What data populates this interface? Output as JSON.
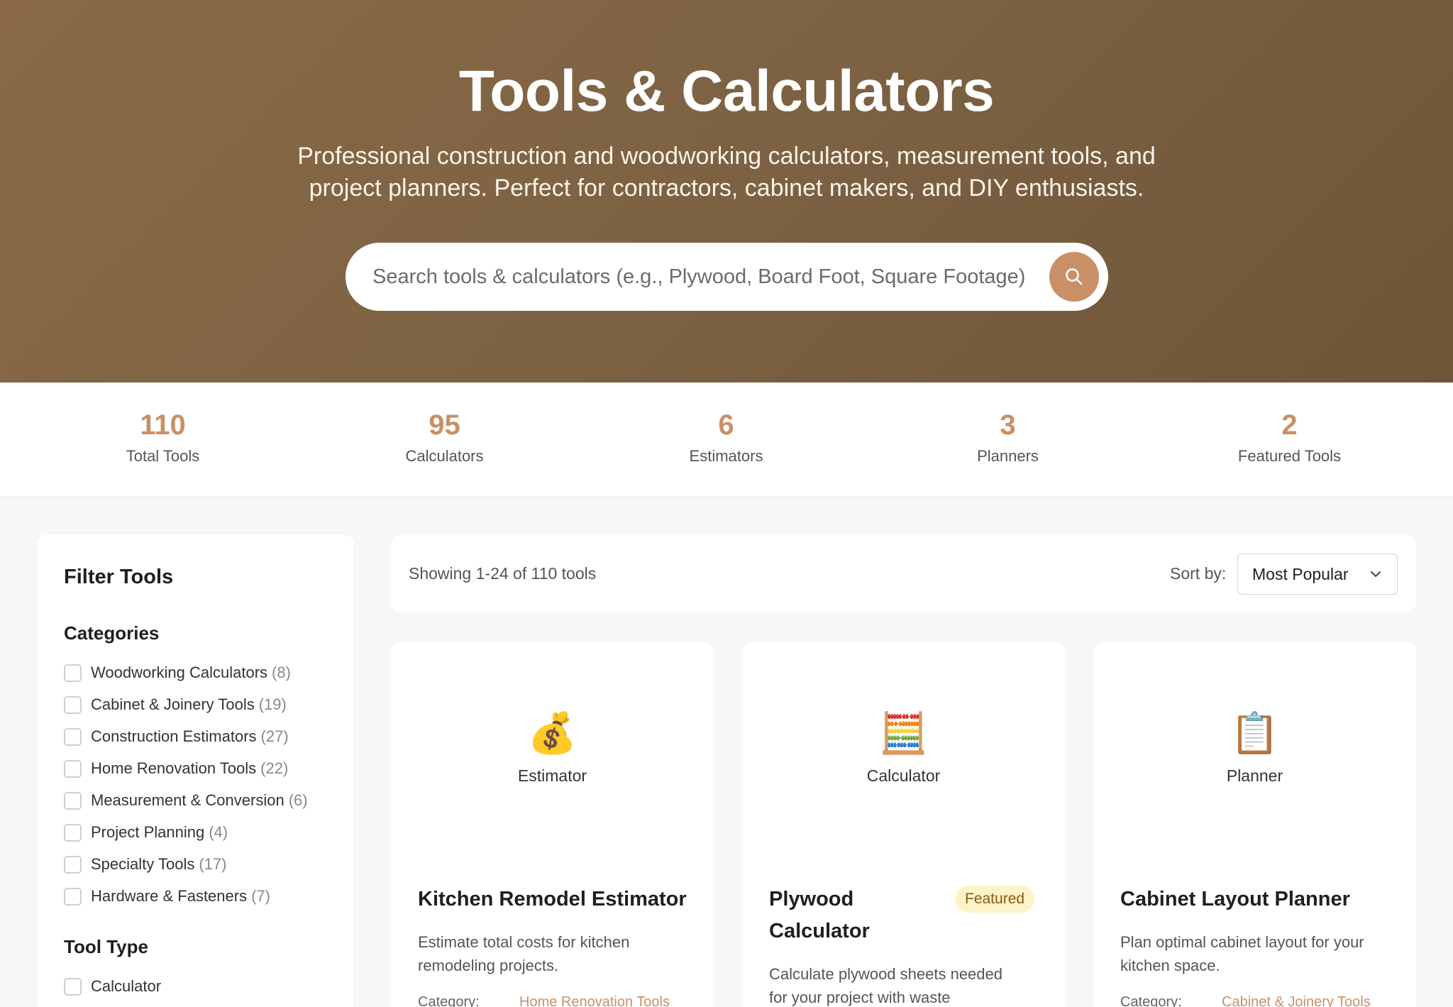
{
  "hero": {
    "title": "Tools & Calculators",
    "subtitle_line1": "Professional construction and woodworking calculators, measurement tools, and",
    "subtitle_line2": "project planners. Perfect for contractors, cabinet makers, and DIY enthusiasts.",
    "search_placeholder": "Search tools & calculators (e.g., Plywood, Board Foot, Square Footage)",
    "search_icon": "search-icon"
  },
  "stats": [
    {
      "value": "110",
      "label": "Total Tools"
    },
    {
      "value": "95",
      "label": "Calculators"
    },
    {
      "value": "6",
      "label": "Estimators"
    },
    {
      "value": "3",
      "label": "Planners"
    },
    {
      "value": "2",
      "label": "Featured Tools"
    }
  ],
  "sidebar": {
    "title": "Filter Tools",
    "categories_heading": "Categories",
    "categories": [
      {
        "label": "Woodworking Calculators",
        "count": "(8)"
      },
      {
        "label": "Cabinet & Joinery Tools",
        "count": "(19)"
      },
      {
        "label": "Construction Estimators",
        "count": "(27)"
      },
      {
        "label": "Home Renovation Tools",
        "count": "(22)"
      },
      {
        "label": "Measurement & Conversion",
        "count": "(6)"
      },
      {
        "label": "Project Planning",
        "count": "(4)"
      },
      {
        "label": "Specialty Tools",
        "count": "(17)"
      },
      {
        "label": "Hardware & Fasteners",
        "count": "(7)"
      }
    ],
    "tool_type_heading": "Tool Type",
    "tool_types": [
      {
        "label": "Calculator"
      }
    ]
  },
  "results": {
    "showing": "Showing 1-24 of 110 tools",
    "sort_label": "Sort by:",
    "sort_value": "Most Popular"
  },
  "cards": [
    {
      "emoji": "💰",
      "type": "Estimator",
      "title": "Kitchen Remodel Estimator",
      "desc_line1": "Estimate total costs for kitchen",
      "desc_line2": "remodeling projects.",
      "category_label": "Category:",
      "category_value": "Home Renovation Tools"
    },
    {
      "emoji": "🧮",
      "type": "Calculator",
      "title_line1": "Plywood",
      "title_line2": "Calculator",
      "badge": "Featured",
      "desc_line1": "Calculate plywood sheets needed",
      "desc_line2": "for your project with waste"
    },
    {
      "emoji": "📋",
      "type": "Planner",
      "title": "Cabinet Layout Planner",
      "desc_line1": "Plan optimal cabinet layout for your",
      "desc_line2": "kitchen space.",
      "category_label": "Category:",
      "category_value": "Cabinet & Joinery Tools"
    }
  ],
  "colors": {
    "accent": "#c99067",
    "hero_bg": "#7c6243"
  }
}
